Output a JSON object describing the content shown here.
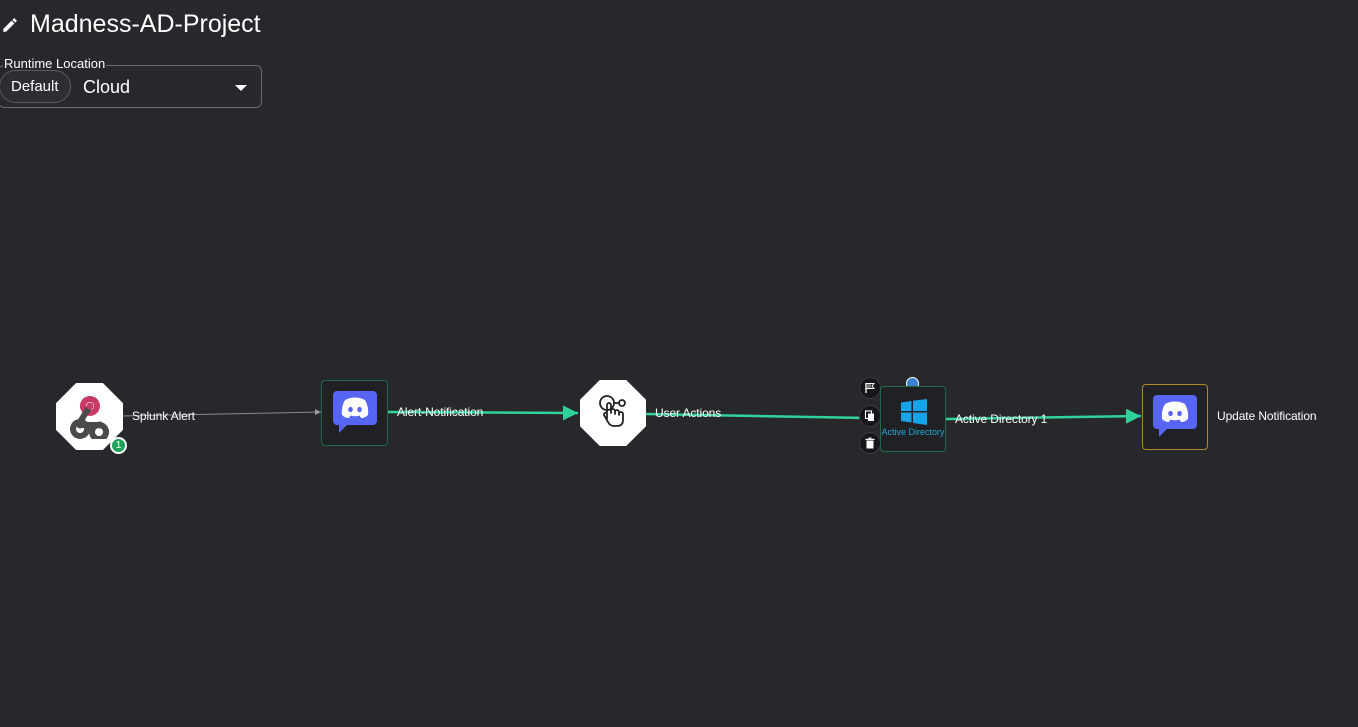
{
  "header": {
    "title": "Madness-AD-Project"
  },
  "runtime": {
    "legend": "Runtime Location",
    "chip": "Default",
    "value": "Cloud"
  },
  "nodes": {
    "splunk_alert": {
      "label": "Splunk Alert",
      "badge": "1"
    },
    "alert_notification": {
      "label": "Alert-Notification"
    },
    "user_actions": {
      "label": "User Actions"
    },
    "active_directory": {
      "label": "Active Directory 1",
      "caption": "Active Directory"
    },
    "update_notification": {
      "label": "Update Notification"
    }
  },
  "colors": {
    "background": "#27282c",
    "edge_active": "#2fd39a",
    "edge_inactive": "#8a8b90",
    "node_border": "#1f6a49",
    "selected_border": "#b08a2a",
    "badge": "#1fa35b",
    "discord": "#5865f2",
    "windows": "#1aa3e8",
    "webhook_pink": "#c73a63"
  }
}
